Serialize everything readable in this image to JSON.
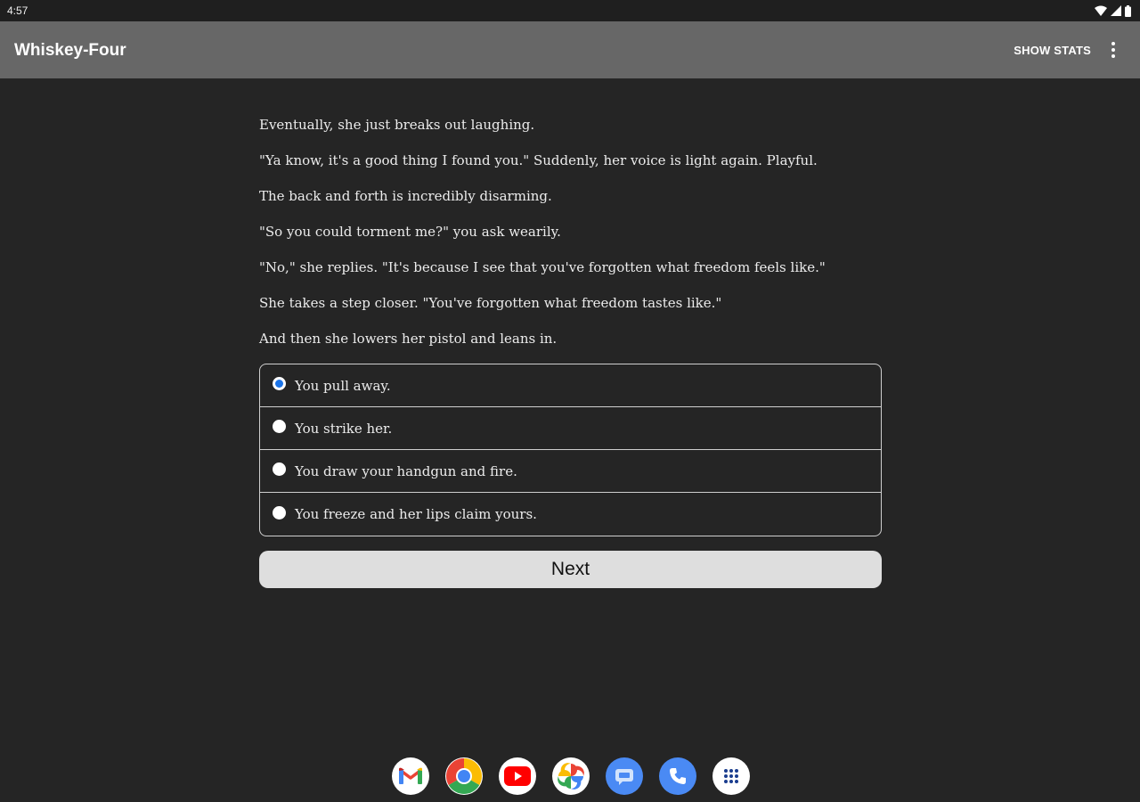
{
  "status_bar": {
    "time": "4:57",
    "icons": [
      "wifi-icon",
      "signal-icon",
      "battery-icon"
    ]
  },
  "app_bar": {
    "title": "Whiskey-Four",
    "show_stats_label": "SHOW STATS",
    "menu_icon": "overflow-menu-icon"
  },
  "story": {
    "paragraphs": [
      "Eventually, she just breaks out laughing.",
      "\"Ya know, it's a good thing I found you.\" Suddenly, her voice is light again. Playful.",
      "The back and forth is incredibly disarming.",
      "\"So you could torment me?\" you ask wearily.",
      "\"No,\" she replies. \"It's because I see that you've forgotten what freedom feels like.\"",
      "She takes a step closer. \"You've forgotten what freedom tastes like.\"",
      "And then she lowers her pistol and leans in."
    ]
  },
  "choices": {
    "selected_index": 0,
    "options": [
      "You pull away.",
      "You strike her.",
      "You draw your handgun and fire.",
      "You freeze and her lips claim yours."
    ]
  },
  "next_button": {
    "label": "Next"
  },
  "dock": {
    "apps": [
      "gmail-icon",
      "chrome-icon",
      "youtube-icon",
      "photos-icon",
      "messages-icon",
      "phone-icon",
      "app-drawer-icon"
    ]
  },
  "colors": {
    "background": "#252525",
    "app_bar": "#676767",
    "radio_selected": "#1a73e8",
    "button": "#dedede"
  }
}
